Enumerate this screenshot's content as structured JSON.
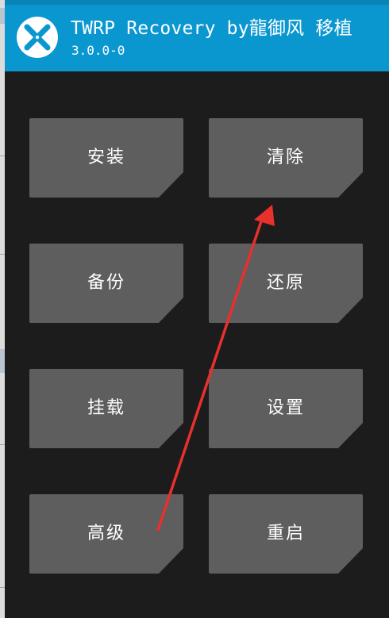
{
  "header": {
    "title": "TWRP Recovery by龍御风 移植",
    "version": "3.0.0-0",
    "logo_icon": "twrp-logo-icon",
    "background_color": "#0a97d0"
  },
  "menu": {
    "buttons": [
      {
        "id": "install",
        "label": "安装"
      },
      {
        "id": "wipe",
        "label": "清除"
      },
      {
        "id": "backup",
        "label": "备份"
      },
      {
        "id": "restore",
        "label": "还原"
      },
      {
        "id": "mount",
        "label": "挂载"
      },
      {
        "id": "settings",
        "label": "设置"
      },
      {
        "id": "advanced",
        "label": "高级"
      },
      {
        "id": "reboot",
        "label": "重启"
      }
    ],
    "button_color": "#5e5e5e"
  },
  "annotation": {
    "type": "red-arrow",
    "from": "高级",
    "to": "清除",
    "color": "#e8302c"
  }
}
